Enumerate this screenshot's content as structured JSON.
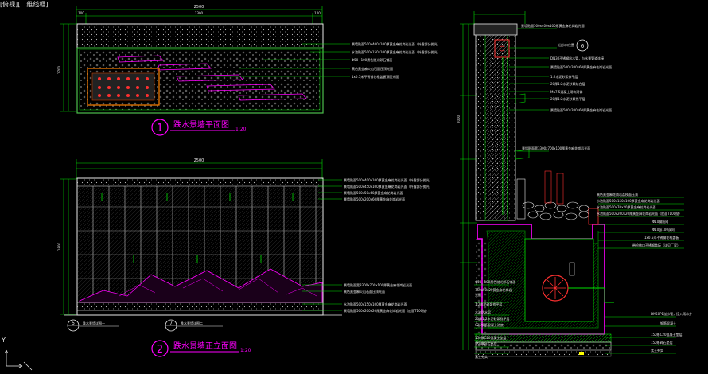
{
  "viewport_label": "[俯视][二维线框]",
  "axis_y": "Y",
  "colors": {
    "bg": "#000000",
    "green": "#00e000",
    "magenta": "#ff00ff",
    "white": "#e8e8e8",
    "yellow": "#ffff00",
    "cyan": "#00ffff",
    "red": "#ff3030"
  },
  "plan": {
    "title": "跌水景墙平面图",
    "number": "1",
    "scale": "1:20",
    "dim_total": "2500",
    "dim_segments": [
      "100",
      "2300",
      "100"
    ],
    "dim_height": "1700",
    "notes": [
      "景墙贴面500x400x100厚黄金麻花岗岩光面（外露部分抛光）",
      "水池贴面500x150x100厚黄金麻花岗岩光面（外露部分抛光）",
      "Φ50~100黑色抛光卵石铺面",
      "黄色黄金麻火山石面压顶光面",
      "1x0.5米不锈钢花格盖板顶面光面"
    ]
  },
  "elevation": {
    "title": "跌水景墙正立面图",
    "number": "2",
    "scale": "1:20",
    "dim_total": "2500",
    "dim_height": "1800",
    "notes_top": [
      "景墙贴面500x400x100厚黄金麻花岗岩光面（外露部分抛光）",
      "景墙贴面500x450x100厚黄金麻花岗岩光面（外露部分抛光）",
      "景墙贴面500x50x60厚黄金麻花岗岩光面",
      "景墙贴面500x200x60厚黄金麻花岗岩光面"
    ],
    "notes_bottom": [
      "景墙贴面宽3300x700x100厚黄金麻花岗岩光面",
      "黄色黄金麻火山石面压顶光面",
      "水池贴面500x150x100厚黄金麻花岗岩光面",
      "景墙贴面500x200x20厚黄金麻花岗岩光面（底面T100抛）"
    ],
    "ref_5": "5",
    "ref_5_text": "跌水景墙详图一",
    "ref_7": "7",
    "ref_7_text": "跌水景墙详图二"
  },
  "section": {
    "ref": "6",
    "dim_height": "2000",
    "notes_top": [
      "景墙贴面500x400x100厚黄金麻花岗岩光面",
      "出水口位置",
      "DN30不锈钢出水管，与水景管道连接",
      "景墙贴面500x200x60厚黄金麻花岗岩光面",
      "1:2水泥砂浆抹平层",
      "20厚1:2水泥砂浆结合层",
      "Mu7.5混凝土砌块砌体",
      "20厚1:2水泥砂浆找平层",
      "景墙贴面500x200x60厚黄金麻花岗岩光面"
    ],
    "note_mid": "景墙贴面宽3300x700x100厚黄金麻花岗岩光面",
    "notes_right": [
      "黄色黄金麻花岗岩荔枝面压顶",
      "水池贴面500x150x100厚黄金麻花岗岩光面",
      "水池贴面500x70x20厚黄金麻花岗岩光面",
      "水池贴面500x200x20厚黄金麻花岗岩光面（底面T100抛）",
      "Φ10钢筋网",
      "Φ10@100双向",
      "1x0.5米不锈钢花格盖板",
      "带检修口不锈钢盖板（详见厂家）"
    ],
    "notes_left": [
      "Φ50~100黑色抛光卵石铺面",
      "750x50x20黄金麻花岗岩",
      "光面",
      "1:2水泥砂浆找平层",
      "水池防水层",
      "20厚1:2水泥砂浆找平层",
      "C25钢筋混凝土池底",
      "150厚C20混凝土垫层",
      "150厚碎石垫层",
      "素土夯实"
    ],
    "notes_lower_right": [
      "DN50PE溢水管，接入雨水井",
      "钢筋混凝土",
      "150厚C20混凝土垫层",
      "150厚碎石垫层",
      "素土夯实"
    ]
  }
}
